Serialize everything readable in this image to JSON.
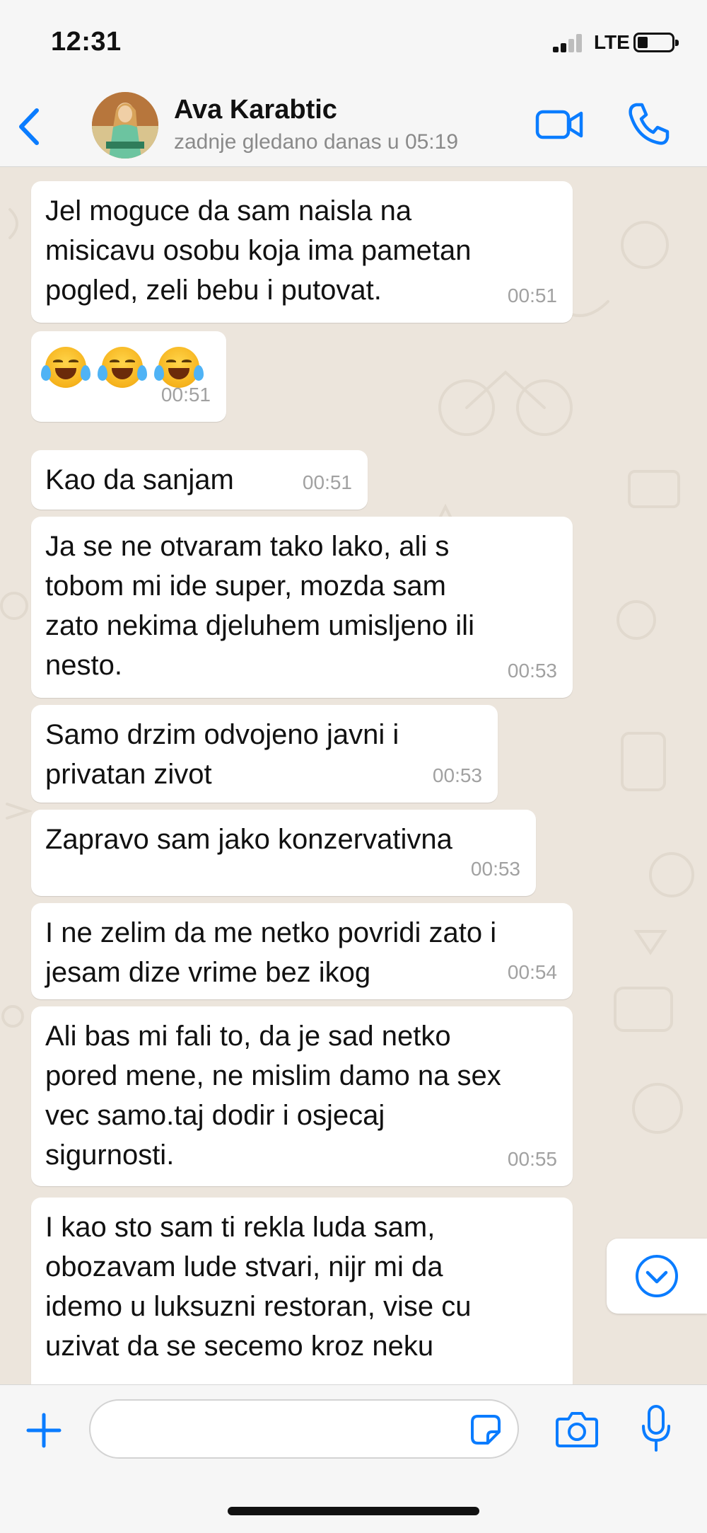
{
  "status_bar": {
    "time": "12:31",
    "network": "LTE"
  },
  "header": {
    "contact_name": "Ava Karabtic",
    "contact_status": "zadnje gledano danas u 05:19"
  },
  "messages": [
    {
      "text": "Jel moguce da sam naisla na\nmisicavu osobu koja ima pametan\npogled, zeli bebu i putovat.",
      "time": "00:51"
    },
    {
      "emoji": [
        "face-with-tears-of-joy",
        "face-with-tears-of-joy",
        "face-with-tears-of-joy"
      ],
      "time": "00:51"
    },
    {
      "text": "Kao da sanjam",
      "time": "00:51"
    },
    {
      "text": "Ja se ne otvaram tako lako, ali s\ntobom mi ide super, mozda sam\nzato nekima djeluhem umisljeno ili\nnesto.",
      "time": "00:53"
    },
    {
      "text": "Samo drzim odvojeno javni i\nprivatan zivot",
      "time": "00:53"
    },
    {
      "text": "Zapravo sam jako konzervativna",
      "time": "00:53"
    },
    {
      "text": "I ne zelim da me netko povridi zato i\njesam dize vrime bez ikog",
      "time": "00:54"
    },
    {
      "text": "Ali bas mi fali to, da je sad netko\npored mene, ne mislim damo na sex\nvec samo.taj dodir i osjecaj\nsigurnosti.",
      "time": "00:55"
    },
    {
      "text": "I kao sto sam ti rekla luda sam,\nobozavam lude stvari, nijr mi da\nidemo u luksuzni restoran, vise cu\nuzivat da se secemo kroz neku"
    }
  ],
  "input_bar": {
    "placeholder": ""
  },
  "colors": {
    "accent": "#0a7cff",
    "chat_background": "#ece5dc",
    "bubble": "#ffffff",
    "timestamp": "#a1a1a1"
  },
  "icons": [
    "back-chevron-icon",
    "video-camera-icon",
    "phone-icon",
    "plus-icon",
    "sticker-icon",
    "camera-icon",
    "microphone-icon",
    "chevron-down-icon"
  ]
}
